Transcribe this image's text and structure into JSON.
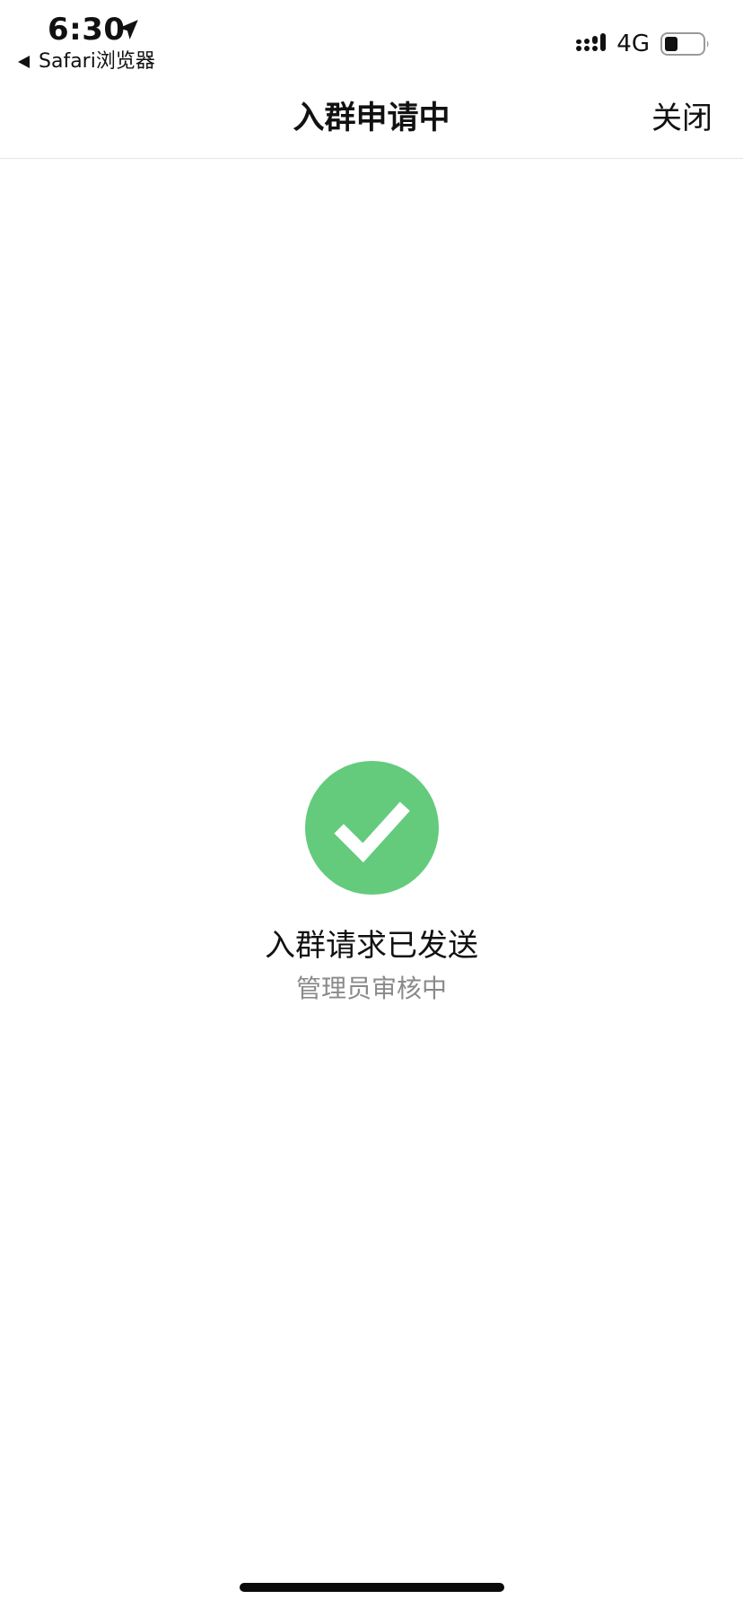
{
  "status_bar": {
    "time": "6:30",
    "back_app_label": "Safari浏览器",
    "network": "4G",
    "battery_level": 0.35
  },
  "nav": {
    "title": "入群申请中",
    "close_label": "关闭"
  },
  "result": {
    "icon": "check-circle-icon",
    "title": "入群请求已发送",
    "description": "管理员审核中"
  },
  "colors": {
    "success_green": "#64CB7C",
    "text_primary": "#111111",
    "text_secondary": "#8A8A8A",
    "divider": "#E6E6E6"
  }
}
